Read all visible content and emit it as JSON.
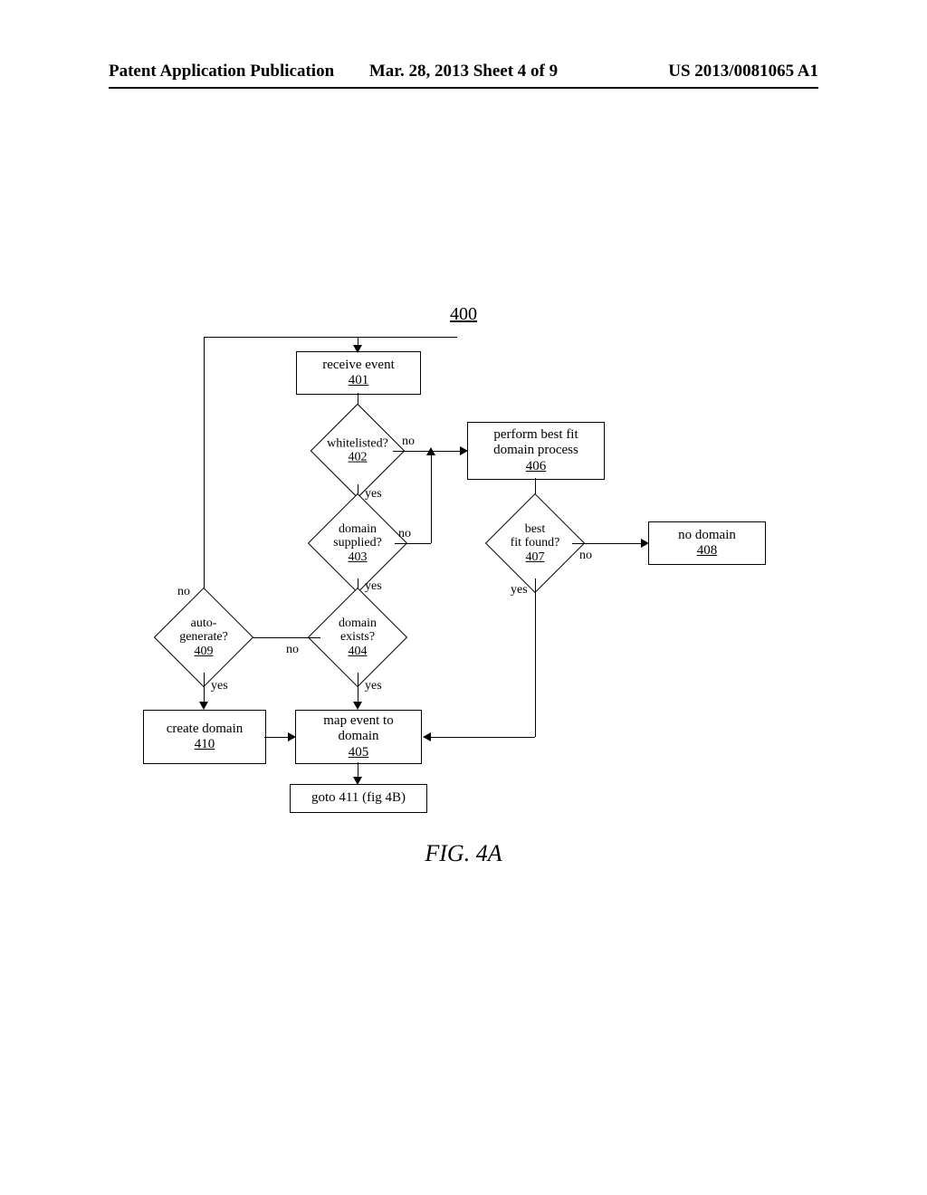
{
  "header": {
    "left": "Patent Application Publication",
    "center": "Mar. 28, 2013  Sheet 4 of 9",
    "right": "US 2013/0081065 A1"
  },
  "figure": {
    "ref": "400",
    "caption": "FIG. 4A"
  },
  "nodes": {
    "n401": {
      "text": "receive event",
      "id": "401"
    },
    "n402": {
      "text": "whitelisted?",
      "id": "402"
    },
    "n403": {
      "text_l1": "domain",
      "text_l2": "supplied?",
      "id": "403"
    },
    "n404": {
      "text_l1": "domain",
      "text_l2": "exists?",
      "id": "404"
    },
    "n405": {
      "text_l1": "map event to",
      "text_l2": "domain",
      "id": "405"
    },
    "n406": {
      "text_l1": "perform best fit",
      "text_l2": "domain process",
      "id": "406"
    },
    "n407": {
      "text_l1": "best",
      "text_l2": "fit found?",
      "id": "407"
    },
    "n408": {
      "text": "no domain",
      "id": "408"
    },
    "n409": {
      "text_l1": "auto-",
      "text_l2": "generate?",
      "id": "409"
    },
    "n410": {
      "text": "create domain",
      "id": "410"
    },
    "n411": {
      "text": "goto 411 (fig 4B)"
    }
  },
  "edges": {
    "no": "no",
    "yes": "yes"
  }
}
